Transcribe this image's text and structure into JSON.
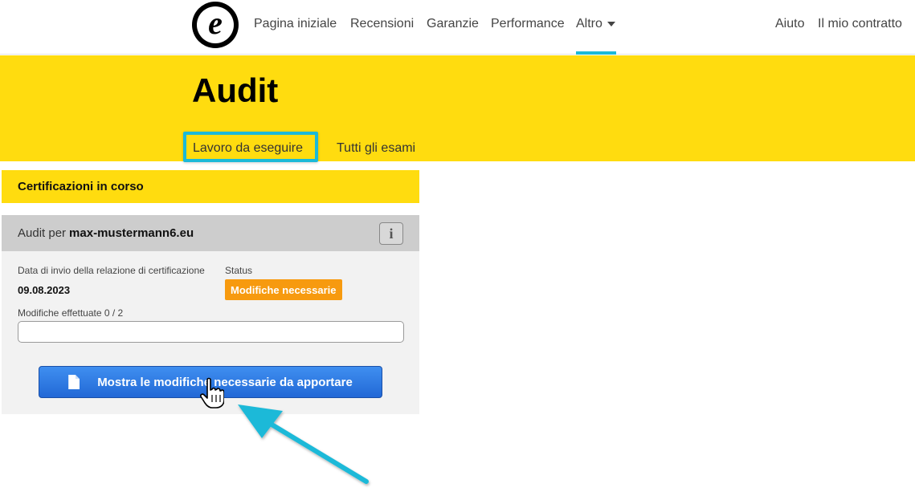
{
  "nav": {
    "logo_letter": "e",
    "links": [
      "Pagina iniziale",
      "Recensioni",
      "Garanzie",
      "Performance"
    ],
    "more_label": "Altro",
    "right_links": [
      "Aiuto",
      "Il mio contratto"
    ],
    "active_color": "#1bb9d8"
  },
  "header": {
    "title": "Audit",
    "tabs": [
      {
        "label": "Lavoro da eseguire",
        "active": true
      },
      {
        "label": "Tutti gli esami",
        "active": false
      }
    ],
    "background": "#ffdc0f"
  },
  "section": {
    "heading": "Certificazioni in corso"
  },
  "card": {
    "title_prefix": "Audit per",
    "domain": "max-mustermann6.eu",
    "info_icon": "i",
    "date_label": "Data di invio della relazione di certificazione",
    "date_value": "09.08.2023",
    "status_label": "Status",
    "status_value": "Modifiche necessarie",
    "status_color": "#f79a0f",
    "changes_label": "Modifiche effettuate 0 / 2",
    "changes_done": 0,
    "changes_total": 2,
    "button_label": "Mostra le modifiche necessarie da apportare",
    "button_icon": "document-icon"
  },
  "annotations": {
    "highlight_color": "#1bb9d8",
    "arrow_color": "#1bb9d8"
  }
}
